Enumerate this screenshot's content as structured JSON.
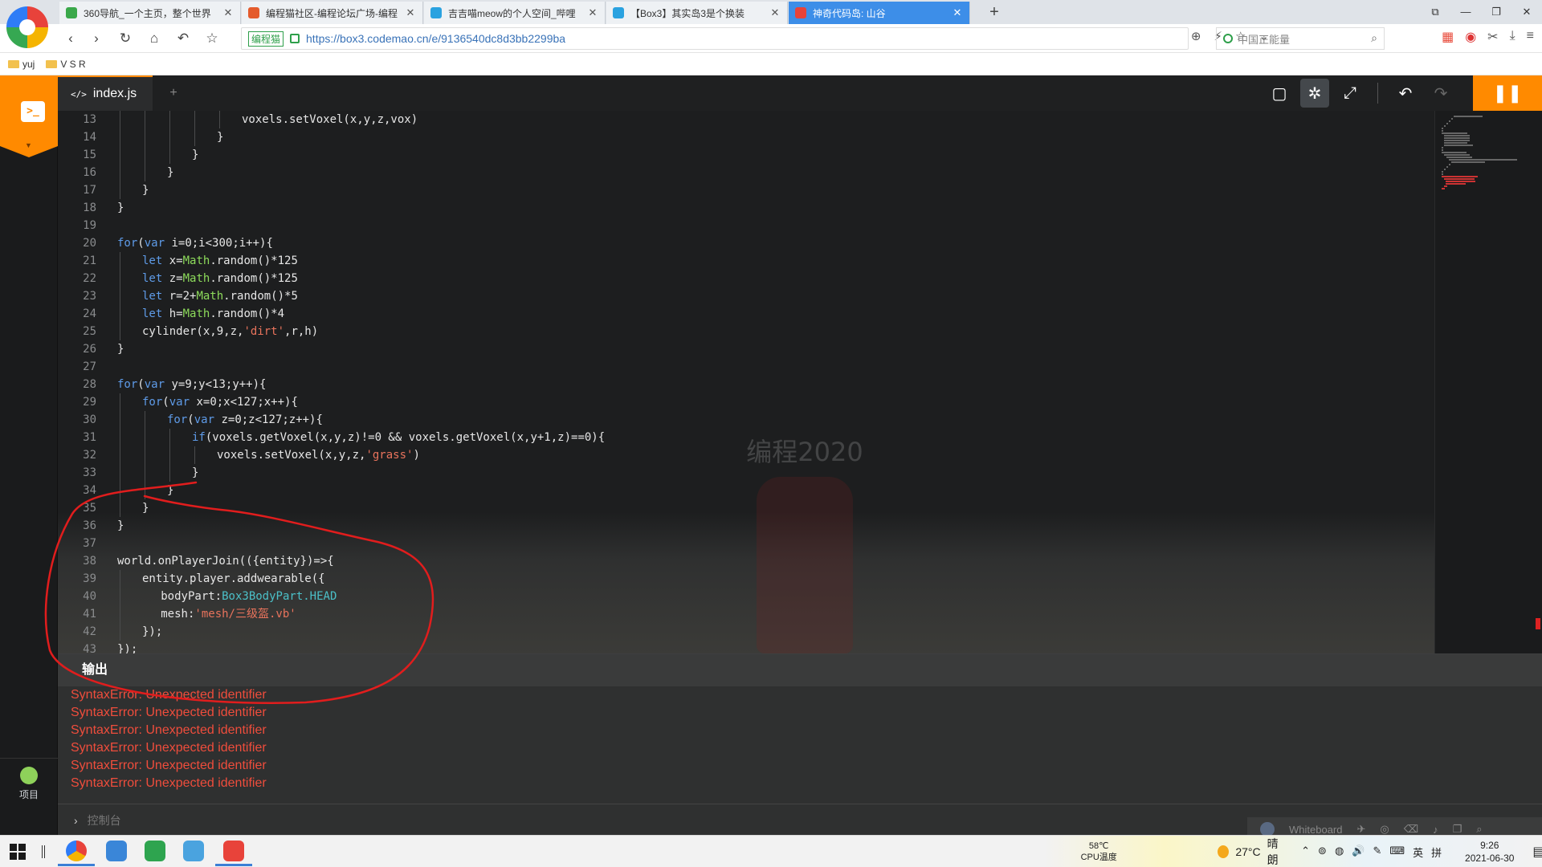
{
  "browser": {
    "tabs": [
      {
        "title": "360导航_一个主页，整个世界",
        "color": "#3aa84a"
      },
      {
        "title": "编程猫社区-编程论坛广场-编程",
        "color": "#e45b2c"
      },
      {
        "title": "吉吉喵meow的个人空间_哔哩",
        "color": "#2aa2e0"
      },
      {
        "title": "【Box3】其实岛3是个换装",
        "color": "#2aa2e0"
      },
      {
        "title": "神奇代码岛: 山谷",
        "color": "#e8433a"
      }
    ],
    "new_tab": "+",
    "window_controls": [
      "⧉",
      "—",
      "❐",
      "✕"
    ],
    "nav": {
      "back": "‹",
      "forward": "›",
      "reload": "↻",
      "home": "⌂",
      "undo": "↶",
      "star": "☆"
    },
    "cert_label": "编程猫",
    "url": "https://box3.codemao.cn/e/9136540dc8d3bb2299ba",
    "addr_actions": [
      "⊕",
      "⚡",
      "☆",
      "⌄"
    ],
    "search_placeholder": "中国正能量",
    "bookmarks": [
      "yuj",
      "V S R"
    ]
  },
  "editor": {
    "file_tab": "index.js",
    "add_file": "+",
    "toolbar": {
      "comment": "▢",
      "debug": "✲",
      "expand": "⤢",
      "undo": "↶",
      "redo": "↷",
      "pause": "❚❚"
    },
    "code_lines": [
      {
        "n": "13",
        "indent": 5,
        "t": "voxels.setVoxel(x,y,z,vox)"
      },
      {
        "n": "14",
        "indent": 4,
        "t": "}"
      },
      {
        "n": "15",
        "indent": 3,
        "t": "}"
      },
      {
        "n": "16",
        "indent": 2,
        "t": "}"
      },
      {
        "n": "17",
        "indent": 1,
        "t": "}"
      },
      {
        "n": "18",
        "indent": 0,
        "t": "}"
      },
      {
        "n": "19",
        "indent": 0,
        "t": ""
      },
      {
        "n": "20",
        "indent": 0,
        "t": "for(var i=0;i<300;i++){"
      },
      {
        "n": "21",
        "indent": 1,
        "t": "let x=Math.random()*125"
      },
      {
        "n": "22",
        "indent": 1,
        "t": "let z=Math.random()*125"
      },
      {
        "n": "23",
        "indent": 1,
        "t": "let r=2+Math.random()*5"
      },
      {
        "n": "24",
        "indent": 1,
        "t": "let h=Math.random()*4"
      },
      {
        "n": "25",
        "indent": 1,
        "t": "cylinder(x,9,z,'dirt',r,h)"
      },
      {
        "n": "26",
        "indent": 0,
        "t": "}"
      },
      {
        "n": "27",
        "indent": 0,
        "t": ""
      },
      {
        "n": "28",
        "indent": 0,
        "t": "for(var y=9;y<13;y++){"
      },
      {
        "n": "29",
        "indent": 1,
        "t": "for(var x=0;x<127;x++){"
      },
      {
        "n": "30",
        "indent": 2,
        "t": "for(var z=0;z<127;z++){"
      },
      {
        "n": "31",
        "indent": 3,
        "t": "if(voxels.getVoxel(x,y,z)!=0 && voxels.getVoxel(x,y+1,z)==0){"
      },
      {
        "n": "32",
        "indent": 4,
        "t": "voxels.setVoxel(x,y,z,'grass')"
      },
      {
        "n": "33",
        "indent": 3,
        "t": "}"
      },
      {
        "n": "34",
        "indent": 2,
        "t": "}"
      },
      {
        "n": "35",
        "indent": 1,
        "t": "}"
      },
      {
        "n": "36",
        "indent": 0,
        "t": "}"
      },
      {
        "n": "37",
        "indent": 0,
        "t": ""
      },
      {
        "n": "38",
        "indent": 0,
        "t": "world.onPlayerJoin(({entity})=>{"
      },
      {
        "n": "39",
        "indent": 1,
        "t": "entity.player.addwearable({"
      },
      {
        "n": "40",
        "indent": 1.75,
        "t": "bodyPart:Box3BodyPart.HEAD"
      },
      {
        "n": "41",
        "indent": 1.75,
        "t": "mesh:'mesh/三级盔.vb'"
      },
      {
        "n": "42",
        "indent": 1,
        "t": "});"
      },
      {
        "n": "43",
        "indent": 0,
        "t": "});"
      }
    ],
    "scene_text": "编程2020"
  },
  "output": {
    "title": "输出",
    "lines": [
      "SyntaxError: Unexpected identifier",
      "SyntaxError: Unexpected identifier",
      "SyntaxError: Unexpected identifier",
      "SyntaxError: Unexpected identifier",
      "SyntaxError: Unexpected identifier",
      "SyntaxError: Unexpected identifier"
    ],
    "console_label": "控制台"
  },
  "sidebar": {
    "project_label": "项目",
    "brand_glyph": ">_"
  },
  "whiteboard": {
    "label": "Whiteboard"
  },
  "taskbar": {
    "cpu_temp": "58℃",
    "cpu_label": "CPU温度",
    "weather_temp": "27°C",
    "weather_desc": "晴朗",
    "tray": [
      "⌃",
      "⊚",
      "◍",
      "🔊",
      "✎",
      "⌨",
      "英",
      "拼"
    ],
    "time": "9:26",
    "date": "2021-06-30",
    "notify": "▤"
  },
  "colors": {
    "accent": "#ff8a00",
    "error": "#ef4d3c",
    "annotation": "#e11d1d"
  }
}
